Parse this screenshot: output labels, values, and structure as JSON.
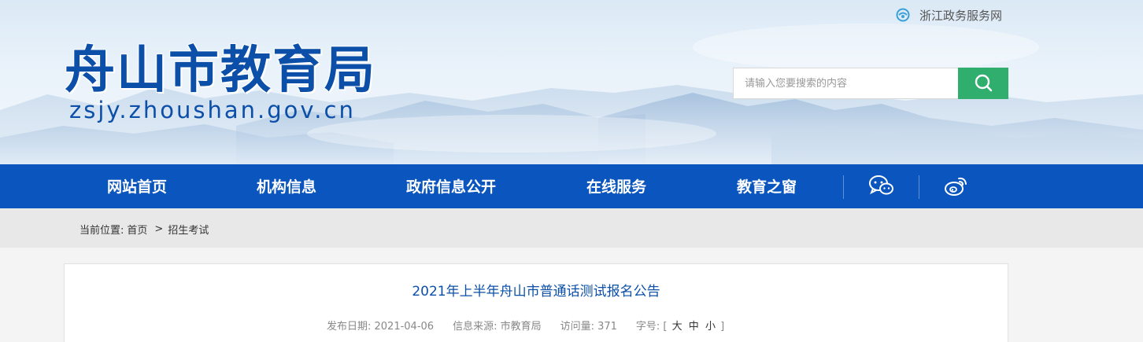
{
  "header": {
    "title": "舟山市教育局",
    "domain": "zsjy.zhoushan.gov.cn",
    "gov_link": "浙江政务服务网",
    "search_placeholder": "请输入您要搜索的内容"
  },
  "nav": {
    "items": [
      "网站首页",
      "机构信息",
      "政府信息公开",
      "在线服务",
      "教育之窗"
    ],
    "icons": [
      "wechat-icon",
      "weibo-icon"
    ]
  },
  "breadcrumb": {
    "prefix": "当前位置:",
    "home": "首页",
    "separator": ">",
    "current": "招生考试"
  },
  "article": {
    "title": "2021年上半年舟山市普通话测试报名公告",
    "publish_date": "发布日期: 2021-04-06",
    "source": "信息来源: 市教育局",
    "views": "访问量: 371",
    "font_size_label": "字号: [",
    "size_large": "大",
    "size_medium": "中",
    "size_small": "小",
    "font_size_close": "]"
  },
  "colors": {
    "nav_bg": "#0b56be",
    "brand_blue": "#0c4fa8",
    "search_btn": "#2fae6e",
    "breadcrumb_bg": "#e8e8e8"
  }
}
